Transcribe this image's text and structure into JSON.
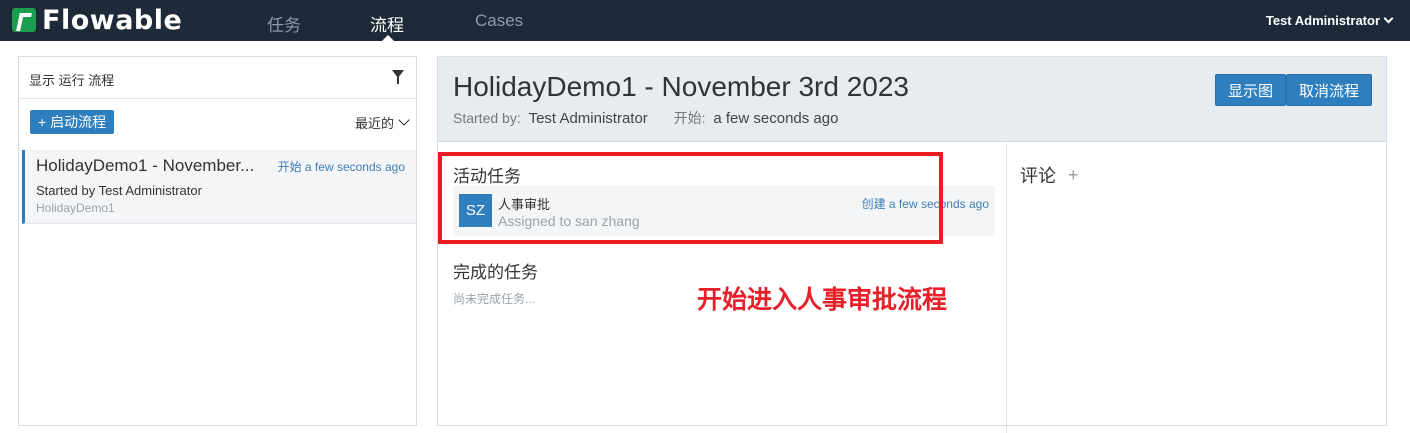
{
  "brand": {
    "logo_text": "Flowable",
    "logo_color": "#1b9e4f",
    "topbar_bg": "#1e2a38"
  },
  "nav": {
    "items": [
      {
        "label": "任务",
        "active": false
      },
      {
        "label": "流程",
        "active": true
      },
      {
        "label": "Cases",
        "active": false
      }
    ],
    "user": "Test Administrator"
  },
  "sidebar": {
    "filter_label": "显示 运行 流程",
    "start_button": "+ 启动流程",
    "sort_label": "最近的",
    "processes": [
      {
        "title": "HolidayDemo1 - November...",
        "time": "开始 a few seconds ago",
        "started_by": "Started by Test Administrator",
        "definition": "HolidayDemo1"
      }
    ]
  },
  "detail": {
    "title": "HolidayDemo1 - November 3rd 2023",
    "started_by_label": "Started by:",
    "started_by_value": "Test Administrator",
    "start_label": "开始:",
    "start_value": "a few seconds ago",
    "buttons": {
      "diagram": "显示图",
      "cancel": "取消流程"
    },
    "active_tasks_title": "活动任务",
    "active_tasks": [
      {
        "avatar": "SZ",
        "name": "人事审批",
        "assigned": "Assigned to san zhang",
        "created": "创建 a few seconds ago"
      }
    ],
    "completed_tasks_title": "完成的任务",
    "completed_empty": "尚未完成任务...",
    "comments_title": "评论",
    "comments_add": "+"
  },
  "annotation": {
    "text": "开始进入人事审批流程",
    "color": "#ec1c24"
  },
  "colors": {
    "accent": "#2f7fbf",
    "link": "#3f7eb8"
  }
}
